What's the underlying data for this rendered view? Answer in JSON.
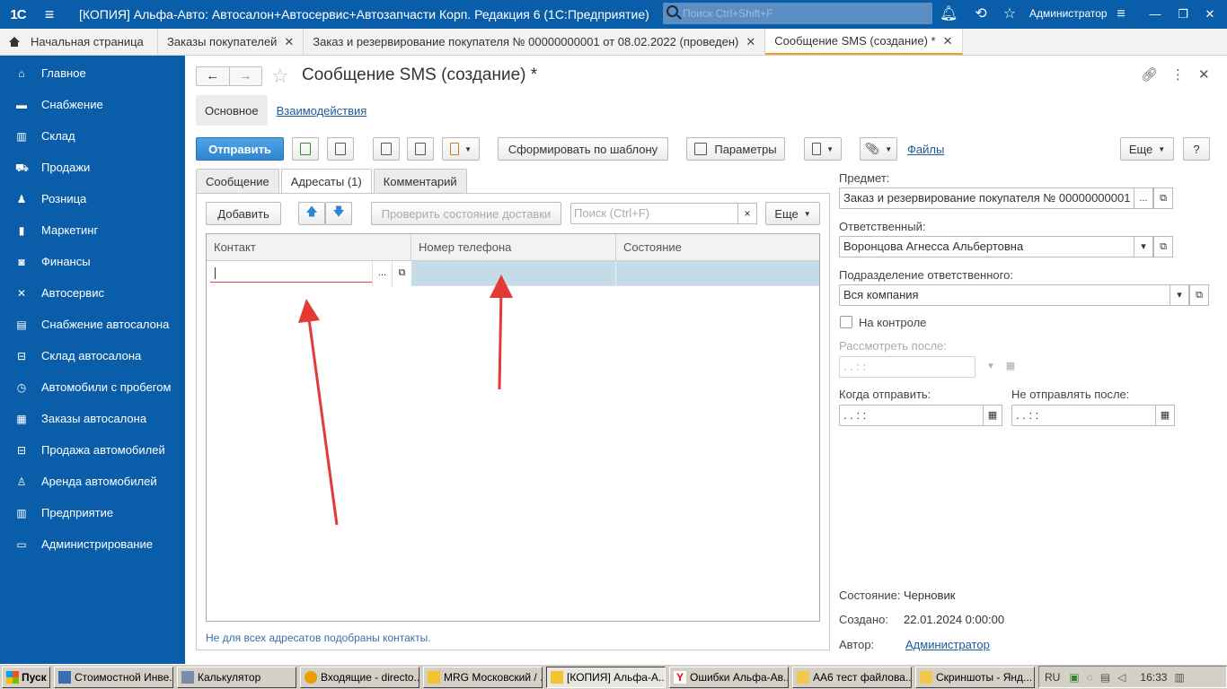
{
  "titlebar": {
    "logo": "1С",
    "title": "[КОПИЯ] Альфа-Авто: Автосалон+Автосервис+Автозапчасти Корп. Редакция 6  (1С:Предприятие)",
    "search_placeholder": "Поиск Ctrl+Shift+F",
    "user": "Администратор"
  },
  "tabs": [
    {
      "label": "Начальная страница"
    },
    {
      "label": "Заказы покупателей"
    },
    {
      "label": "Заказ и резервирование покупателя № 00000000001 от 08.02.2022 (проведен)"
    },
    {
      "label": "Сообщение SMS (создание) *"
    }
  ],
  "sidebar": {
    "items": [
      {
        "label": "Главное",
        "icon": "home-icon"
      },
      {
        "label": "Снабжение",
        "icon": "truck-icon"
      },
      {
        "label": "Склад",
        "icon": "warehouse-icon"
      },
      {
        "label": "Продажи",
        "icon": "cart-icon"
      },
      {
        "label": "Розница",
        "icon": "person-icon"
      },
      {
        "label": "Маркетинг",
        "icon": "chart-icon"
      },
      {
        "label": "Финансы",
        "icon": "finance-icon"
      },
      {
        "label": "Автосервис",
        "icon": "wrench-icon"
      },
      {
        "label": "Снабжение автосалона",
        "icon": "clipboard-icon"
      },
      {
        "label": "Склад автосалона",
        "icon": "car-icon"
      },
      {
        "label": "Автомобили с пробегом",
        "icon": "history-icon"
      },
      {
        "label": "Заказы автосалона",
        "icon": "document-icon"
      },
      {
        "label": "Продажа автомобилей",
        "icon": "car-icon"
      },
      {
        "label": "Аренда автомобилей",
        "icon": "person-car-icon"
      },
      {
        "label": "Предприятие",
        "icon": "building-icon"
      },
      {
        "label": "Администрирование",
        "icon": "monitor-icon"
      }
    ]
  },
  "form": {
    "title": "Сообщение SMS (создание) *",
    "sections": [
      "Основное",
      "Взаимодействия"
    ],
    "toolbar": {
      "send": "Отправить",
      "template": "Сформировать по шаблону",
      "params": "Параметры",
      "files": "Файлы",
      "more": "Еще",
      "help": "?"
    },
    "inner_tabs": [
      "Сообщение",
      "Адресаты (1)",
      "Комментарий"
    ],
    "addr_toolbar": {
      "add": "Добавить",
      "check": "Проверить состояние доставки",
      "search_placeholder": "Поиск (Ctrl+F)",
      "clear": "×",
      "more": "Еще"
    },
    "grid": {
      "columns": [
        "Контакт",
        "Номер телефона",
        "Состояние"
      ],
      "rows": [
        {
          "contact": "",
          "phone": "",
          "state": ""
        }
      ],
      "ellipsis": "..."
    },
    "notice": "Не для всех адресатов подобраны контакты.",
    "right": {
      "subject_label": "Предмет:",
      "subject_value": "Заказ и резервирование покупателя № 00000000001 от 08.02.2022",
      "responsible_label": "Ответственный:",
      "responsible_value": "Воронцова Агнесса Альбертовна",
      "dept_label": "Подразделение ответственного:",
      "dept_value": "Вся компания",
      "control_label": "На контроле",
      "review_label": "Рассмотреть после:",
      "review_value": " .  .       :  :",
      "send_when_label": "Когда отправить:",
      "send_when_value": " .  .       :  :",
      "no_send_after_label": "Не отправлять после:",
      "no_send_after_value": " .  .       :  :",
      "state_label": "Состояние:",
      "state_value": "Черновик",
      "created_label": "Создано:",
      "created_value": "22.01.2024 0:00:00",
      "author_label": "Автор:",
      "author_value": "Администратор"
    }
  },
  "taskbar": {
    "start": "Пуск",
    "items": [
      "Стоимостной Инве...",
      "Калькулятор",
      "Входящие - directo...",
      "MRG Московский / ...",
      "[КОПИЯ] Альфа-А...",
      "Ошибки Альфа-Ав...",
      "АА6 тест файлова...",
      "Скриншоты - Янд..."
    ],
    "lang": "RU",
    "time": "16:33"
  },
  "colors": {
    "brand": "#0a5ea9",
    "primary_button": "#2f86d0",
    "selected_row": "#c5dbe8",
    "annotation_arrow": "#e53935"
  }
}
